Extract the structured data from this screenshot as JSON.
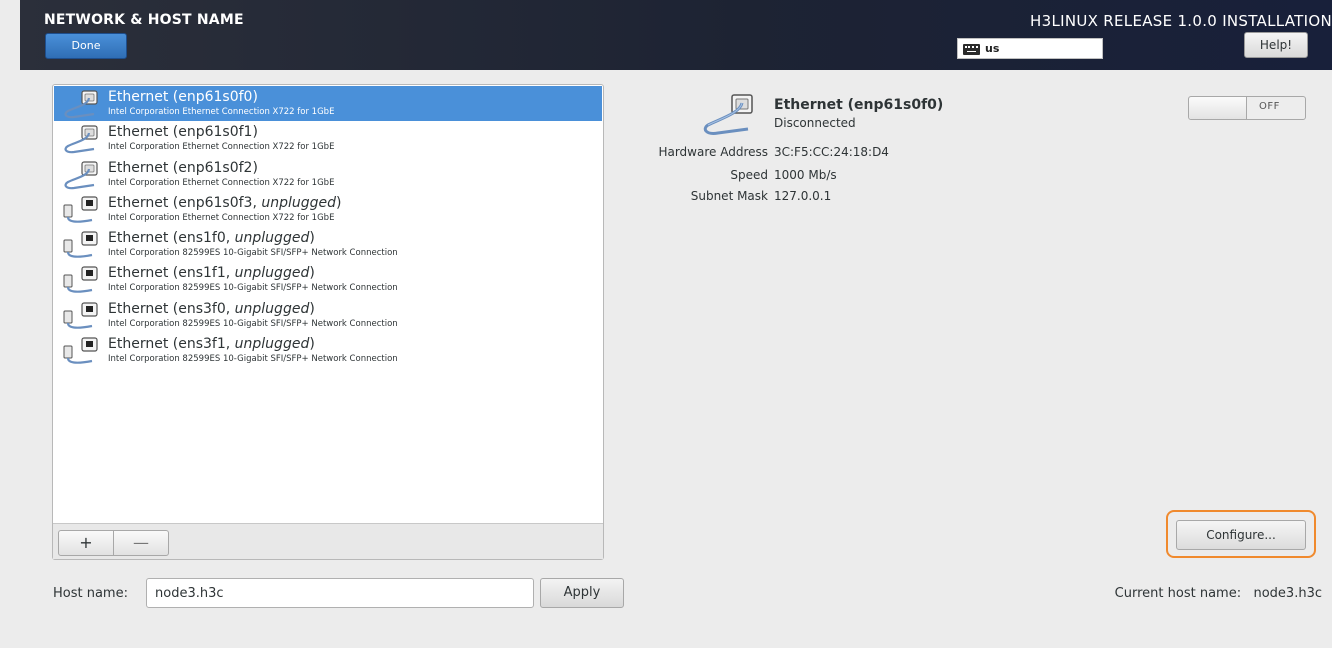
{
  "header": {
    "title": "NETWORK & HOST NAME",
    "done_label": "Done",
    "release_title": "H3LINUX RELEASE 1.0.0 INSTALLATION",
    "keyboard_layout": "us",
    "help_label": "Help!"
  },
  "devices": [
    {
      "name": "Ethernet (enp61s0f0)",
      "state": "",
      "description": "Intel Corporation Ethernet Connection X722 for 1GbE",
      "selected": true,
      "icon": "ethernet-connected-icon"
    },
    {
      "name": "Ethernet (enp61s0f1)",
      "state": "",
      "description": "Intel Corporation Ethernet Connection X722 for 1GbE",
      "selected": false,
      "icon": "ethernet-connected-icon"
    },
    {
      "name": "Ethernet (enp61s0f2)",
      "state": "",
      "description": "Intel Corporation Ethernet Connection X722 for 1GbE",
      "selected": false,
      "icon": "ethernet-connected-icon"
    },
    {
      "name": "Ethernet (enp61s0f3, ",
      "state": "unplugged",
      "description": "Intel Corporation Ethernet Connection X722 for 1GbE",
      "selected": false,
      "icon": "ethernet-unplugged-icon"
    },
    {
      "name": "Ethernet (ens1f0, ",
      "state": "unplugged",
      "description": "Intel Corporation 82599ES 10-Gigabit SFI/SFP+ Network Connection",
      "selected": false,
      "icon": "ethernet-unplugged-icon"
    },
    {
      "name": "Ethernet (ens1f1, ",
      "state": "unplugged",
      "description": "Intel Corporation 82599ES 10-Gigabit SFI/SFP+ Network Connection",
      "selected": false,
      "icon": "ethernet-unplugged-icon"
    },
    {
      "name": "Ethernet (ens3f0, ",
      "state": "unplugged",
      "description": "Intel Corporation 82599ES 10-Gigabit SFI/SFP+ Network Connection",
      "selected": false,
      "icon": "ethernet-unplugged-icon"
    },
    {
      "name": "Ethernet (ens3f1, ",
      "state": "unplugged",
      "description": "Intel Corporation 82599ES 10-Gigabit SFI/SFP+ Network Connection",
      "selected": false,
      "icon": "ethernet-unplugged-icon"
    }
  ],
  "list_toolbar": {
    "add_label": "+",
    "remove_label": "—"
  },
  "detail": {
    "title": "Ethernet (enp61s0f0)",
    "status": "Disconnected",
    "toggle_label": "OFF",
    "toggle_on": false,
    "properties": [
      {
        "label": "Hardware Address",
        "value": "3C:F5:CC:24:18:D4"
      },
      {
        "label": "Speed",
        "value": "1000 Mb/s"
      },
      {
        "label": "Subnet Mask",
        "value": "127.0.0.1"
      }
    ],
    "configure_label": "Configure..."
  },
  "hostname": {
    "label": "Host name:",
    "value": "node3.h3c",
    "apply_label": "Apply",
    "current_label": "Current host name:",
    "current_value": "node3.h3c"
  },
  "colors": {
    "selection": "#4a90d9",
    "header_bg": "#1d2333",
    "highlight": "#f08a2e"
  }
}
